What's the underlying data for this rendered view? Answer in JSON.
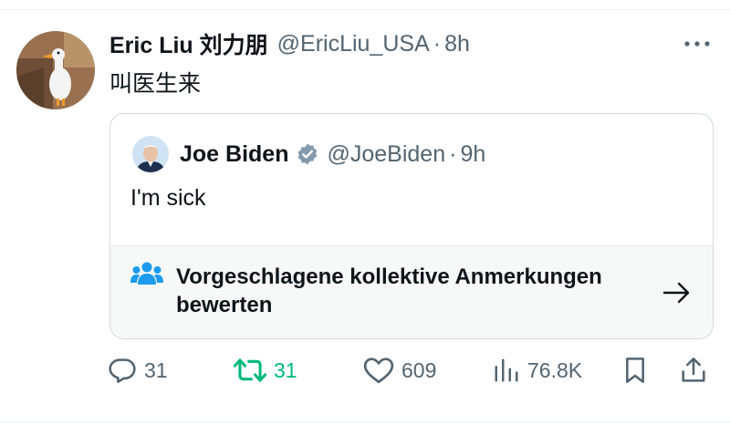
{
  "tweet": {
    "author_name": "Eric Liu 刘力朋",
    "author_handle": "@EricLiu_USA",
    "separator": "·",
    "time": "8h",
    "text": "叫医生来",
    "more_icon": "more-horizontal-icon"
  },
  "quoted_tweet": {
    "author_name": "Joe Biden",
    "verified": true,
    "badge_icon": "verified-gray-badge-icon",
    "author_handle": "@JoeBiden",
    "separator": "·",
    "time": "9h",
    "text": "I'm sick"
  },
  "community_notes": {
    "icon": "people-group-icon",
    "label": "Vorgeschlagene kollektive Anmerkungen bewerten",
    "arrow_icon": "arrow-right-icon"
  },
  "actions": {
    "reply_count": "31",
    "retweet_count": "31",
    "retweet_active": true,
    "like_count": "609",
    "views_count": "76.8K",
    "icons": [
      "reply-icon",
      "retweet-icon",
      "like-icon",
      "views-icon",
      "bookmark-icon",
      "share-icon"
    ]
  },
  "colors": {
    "text_primary": "#0f1419",
    "text_secondary": "#536471",
    "retweet_active": "#00ba7c",
    "notes_icon": "#1d9bf0",
    "border": "#cfd9de"
  }
}
